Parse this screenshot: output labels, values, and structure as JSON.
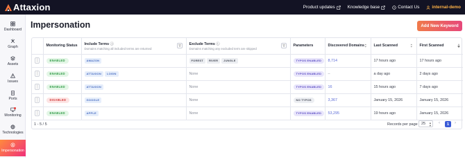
{
  "brand": {
    "name": "Attaxion"
  },
  "topnav": {
    "product_updates": "Product updates",
    "knowledge_base": "Knowledge base",
    "contact_us": "Contact Us",
    "account": "internal-demo"
  },
  "sidebar": {
    "items": [
      {
        "label": "Dashboard",
        "icon": "grid-icon"
      },
      {
        "label": "Graph",
        "icon": "graph-icon"
      },
      {
        "label": "Assets",
        "icon": "layers-icon"
      },
      {
        "label": "Issues",
        "icon": "warning-icon"
      },
      {
        "label": "Ports",
        "icon": "server-icon"
      },
      {
        "label": "Monitoring",
        "icon": "monitoring-icon"
      },
      {
        "label": "Technologies",
        "icon": "stack-icon"
      },
      {
        "label": "Impersonation",
        "icon": "impersonation-icon"
      }
    ]
  },
  "page": {
    "title": "Impersonation",
    "add_button": "Add New Keyword"
  },
  "table": {
    "headers": {
      "status": "Monitoring Status",
      "include": "Include Terms",
      "include_sub": "Domains matching all included terms are returned",
      "exclude": "Exclude Terms",
      "exclude_sub": "Domains matching any excluded term are skipped",
      "parameters": "Parameters",
      "discovered": "Discovered Domains",
      "last_scanned": "Last Scanned",
      "first_scanned": "First Scanned"
    },
    "rows": [
      {
        "status": "ENABLED",
        "status_kind": "enabled",
        "include": [
          "AMAZON"
        ],
        "exclude": [
          "FOREST",
          "RIVER",
          "JUNGLE"
        ],
        "param": "TYPOS ENABLED",
        "param_kind": "typos",
        "discovered": "8,714",
        "last": "17 hours ago",
        "first": "17 hours ago"
      },
      {
        "status": "ENABLED",
        "status_kind": "enabled",
        "include": [
          "ATTAXION",
          "LOGIN"
        ],
        "exclude": [],
        "param": "TYPOS ENABLED",
        "param_kind": "typos",
        "discovered": "–",
        "last": "a day ago",
        "first": "2 days ago"
      },
      {
        "status": "ENABLED",
        "status_kind": "enabled",
        "include": [
          "ATTAXION"
        ],
        "exclude": [],
        "param": "TYPOS ENABLED",
        "param_kind": "typos",
        "discovered": "16",
        "last": "15 hours ago",
        "first": "7 days ago"
      },
      {
        "status": "DISABLED",
        "status_kind": "disabled",
        "include": [
          "GOOGLE"
        ],
        "exclude": [],
        "param": "NO TYPOS",
        "param_kind": "notypos",
        "discovered": "3,367",
        "last": "January 15, 2026",
        "first": "January 15, 2026"
      },
      {
        "status": "ENABLED",
        "status_kind": "enabled",
        "include": [
          "APPLE"
        ],
        "exclude": [],
        "param": "TYPOS ENABLED",
        "param_kind": "typos",
        "discovered": "53,295",
        "last": "19 hours ago",
        "first": "January 15, 2026"
      }
    ],
    "none_label": "None"
  },
  "footer": {
    "count": "1 - 5 / 5",
    "records_label": "Records per page",
    "records_value": "25",
    "current_page": "1"
  },
  "colors": {
    "topbar": "#131324",
    "accent_orange": "#f07a4a",
    "accent_pink": "#e6487a",
    "account": "#ffb347",
    "page_active": "#3a5bd6"
  }
}
